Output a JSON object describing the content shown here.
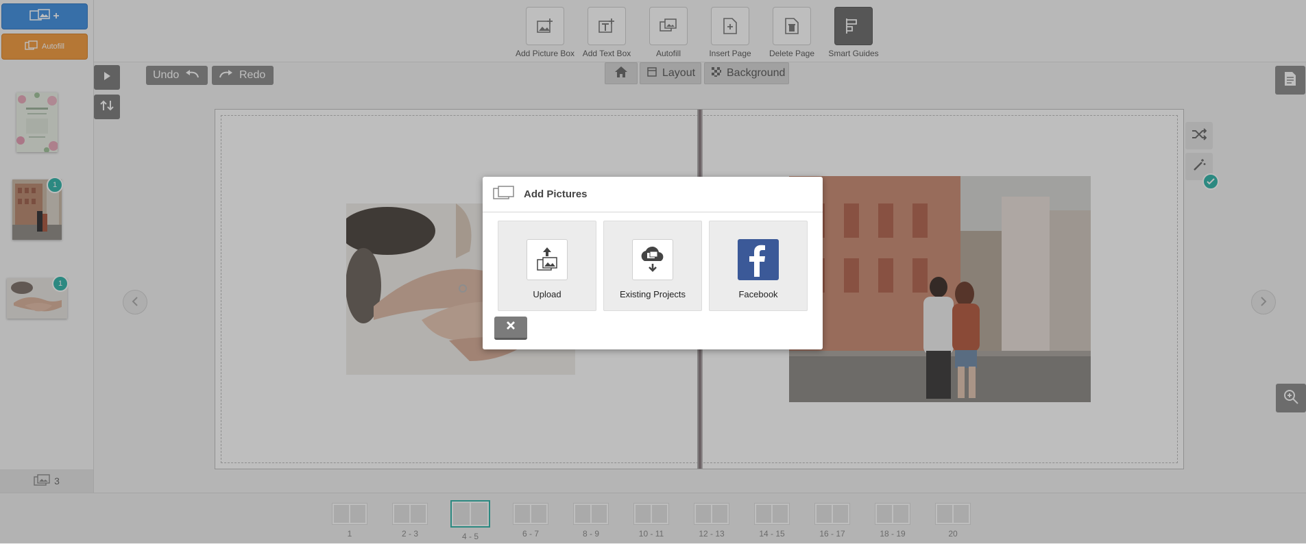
{
  "toolbar": {
    "tools": [
      {
        "label": "Add Picture Box",
        "icon": "add-picture-box-icon"
      },
      {
        "label": "Add Text Box",
        "icon": "add-text-box-icon"
      },
      {
        "label": "Autofill",
        "icon": "autofill-icon"
      },
      {
        "label": "Insert Page",
        "icon": "insert-page-icon"
      },
      {
        "label": "Delete Page",
        "icon": "delete-page-icon"
      },
      {
        "label": "Smart Guides",
        "icon": "smart-guides-icon",
        "active": true
      }
    ]
  },
  "sidebar": {
    "autofill_label": "Autofill",
    "photo_count": "3",
    "thumbnails": [
      {
        "name": "floral-card",
        "badge": ""
      },
      {
        "name": "couple-building",
        "badge": "1"
      },
      {
        "name": "hands",
        "badge": "1"
      }
    ]
  },
  "history": {
    "undo_label": "Undo",
    "redo_label": "Redo"
  },
  "view_tabs": {
    "layout_label": "Layout",
    "background_label": "Background"
  },
  "modal": {
    "title": "Add Pictures",
    "options": [
      {
        "label": "Upload",
        "icon": "upload-icon"
      },
      {
        "label": "Existing Projects",
        "icon": "cloud-download-icon"
      },
      {
        "label": "Facebook",
        "icon": "facebook-icon"
      }
    ]
  },
  "pages": [
    "1",
    "2 - 3",
    "4 - 5",
    "6 - 7",
    "8 - 9",
    "10 - 11",
    "12 - 13",
    "14 - 15",
    "16 - 17",
    "18 - 19",
    "20"
  ],
  "current_page": "4 - 5",
  "colors": {
    "accent": "#2eb3a8",
    "add_button": "#3e8ee0",
    "autofill_button": "#f29a3c",
    "facebook": "#3b5998"
  }
}
